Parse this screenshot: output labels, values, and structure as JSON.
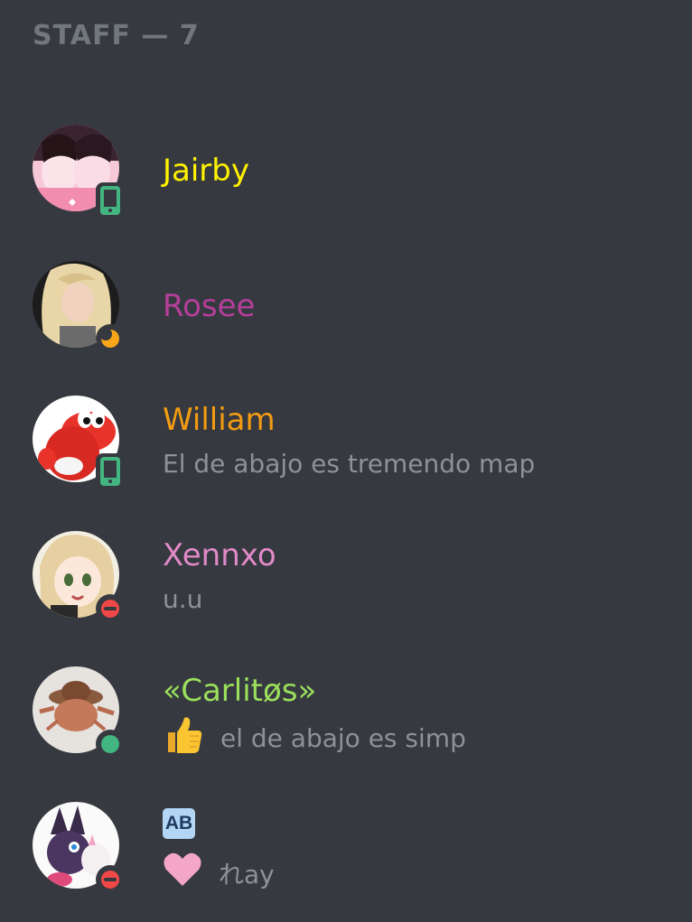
{
  "header": {
    "title": "STAFF — 7"
  },
  "members": [
    {
      "name": "Jairby",
      "name_color": "#fff200",
      "status": "mobile",
      "activity": ""
    },
    {
      "name": "Rosee",
      "name_color": "#b53e9a",
      "status": "idle",
      "activity": ""
    },
    {
      "name": "William",
      "name_color": "#f39c12",
      "status": "mobile",
      "activity": "El de abajo es tremendo map"
    },
    {
      "name": "Xennxo",
      "name_color": "#e08ac8",
      "status": "dnd",
      "activity": "u.u"
    },
    {
      "name": "«Carlitøs»",
      "name_color": "#9be05c",
      "status": "online",
      "activity_emoji": "thumbs-up",
      "activity": "el de abajo es simp"
    },
    {
      "name": "AB",
      "name_color": "#b3d6f5",
      "status": "dnd",
      "activity_emoji": "pink-heart",
      "activity": "れay"
    }
  ],
  "colors": {
    "background": "#36393f",
    "online": "#43b581",
    "idle": "#faa61a",
    "dnd": "#f04747",
    "mobile": "#43b581",
    "muted_text": "#8e9297",
    "header_text": "#72767d"
  }
}
